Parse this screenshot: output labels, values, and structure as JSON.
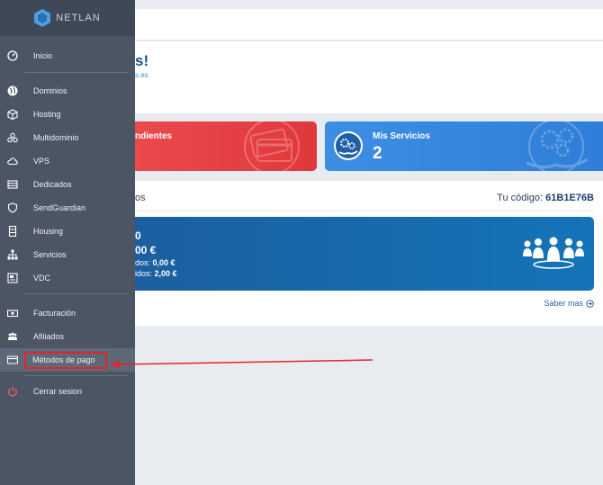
{
  "brand": {
    "name": "NETLAN"
  },
  "sidebar": {
    "items": [
      {
        "label": "Inicio",
        "icon": "dashboard-icon"
      },
      {
        "label": "Dominios",
        "icon": "globe-icon"
      },
      {
        "label": "Hosting",
        "icon": "box-icon"
      },
      {
        "label": "Multidominio",
        "icon": "cluster-icon"
      },
      {
        "label": "VPS",
        "icon": "cloud-icon"
      },
      {
        "label": "Dedicados",
        "icon": "server-icon"
      },
      {
        "label": "SendGuardian",
        "icon": "shield-icon"
      },
      {
        "label": "Housing",
        "icon": "rack-icon"
      },
      {
        "label": "Servicios",
        "icon": "network-icon"
      },
      {
        "label": "VDC",
        "icon": "vdc-icon"
      },
      {
        "label": "Facturación",
        "icon": "money-icon"
      },
      {
        "label": "Afiliados",
        "icon": "people-icon"
      },
      {
        "label": "Métodos de pago",
        "icon": "card-icon"
      },
      {
        "label": "Cerrar sesion",
        "icon": "power-icon"
      }
    ]
  },
  "welcome": {
    "title": "s!",
    "subtitle": "s.es"
  },
  "cards": {
    "pending": {
      "title": "ndientes"
    },
    "services": {
      "title": "Mis Servicios",
      "count": "2"
    }
  },
  "affiliates": {
    "heading": "os",
    "code_label": "Tu código:",
    "code_value": "61B1E76B",
    "line1": "0",
    "line2": "00 €",
    "line3_label": "dos:",
    "line3_value": "0,00 €",
    "line4_label": "idos:",
    "line4_value": "2,00 €",
    "more_link": "Saber mas"
  },
  "colors": {
    "sidebar": "#4b5564",
    "accent_red": "#e0383b",
    "accent_blue": "#2f7ed9",
    "highlight": "#e0262b"
  }
}
